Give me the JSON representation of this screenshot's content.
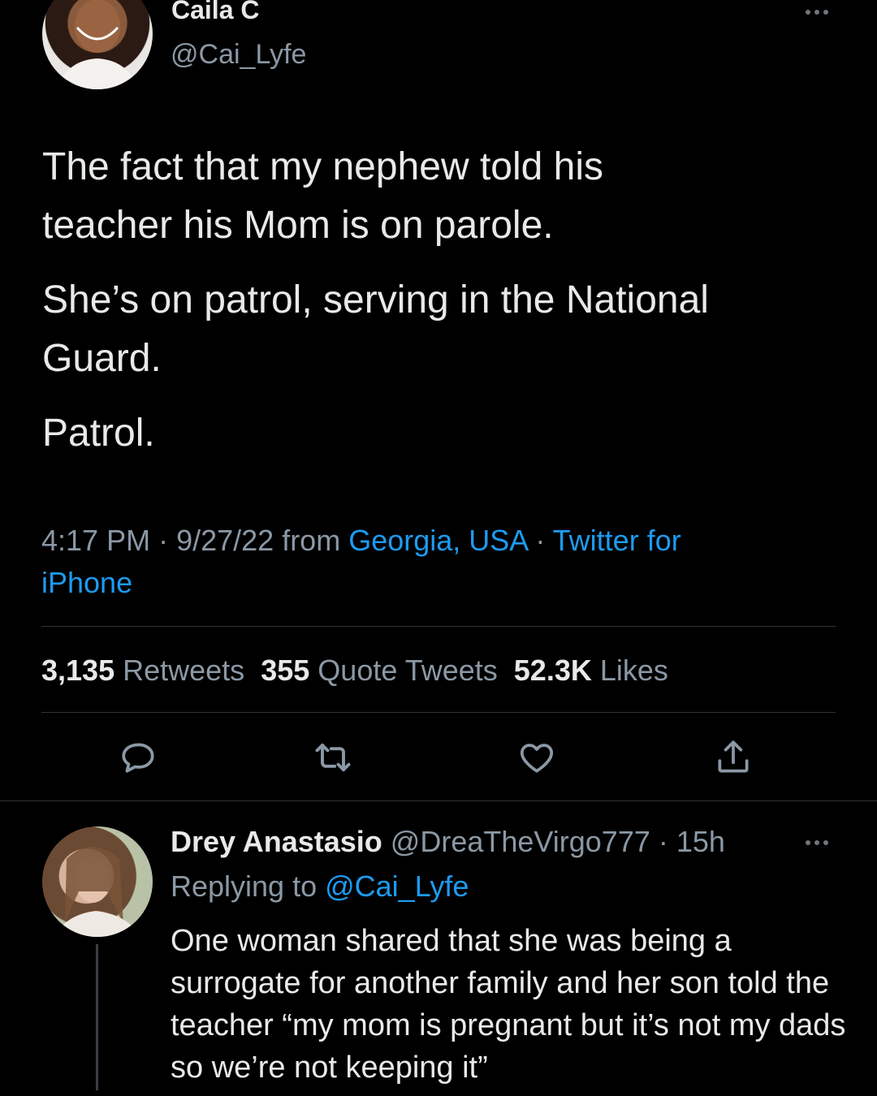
{
  "tweet": {
    "author_name": "Caila C",
    "author_handle": "@Cai_Lyfe",
    "paragraphs": [
      "The fact that my nephew told his teacher his Mom is on parole.",
      "She’s on patrol, serving in the National Guard.",
      "Patrol."
    ],
    "time": "4:17 PM",
    "sep1": " · ",
    "date": "9/27/22 from ",
    "location": "Georgia, USA",
    "sep2": " · ",
    "source": "Twitter for iPhone",
    "stats": {
      "retweets_count": "3,135",
      "retweets_label": "Retweets",
      "quotes_count": "355",
      "quotes_label": "Quote Tweets",
      "likes_count": "52.3K",
      "likes_label": "Likes"
    },
    "actions": {
      "reply_icon": "reply-icon",
      "retweet_icon": "retweet-icon",
      "like_icon": "heart-icon",
      "share_icon": "share-icon"
    }
  },
  "reply": {
    "author_name": "Drey Anastasio",
    "author_handle": "@DreaTheVirgo777",
    "time": " · 15h",
    "replying_prefix": "Replying to ",
    "replying_handle": "@Cai_Lyfe",
    "text": "One woman shared that she was being a surrogate for another family and her son told the teacher “my mom is pregnant but it’s not my dads so we’re not keeping it”"
  },
  "colors": {
    "background": "#000000",
    "text": "#e7e9ea",
    "muted": "#8b98a5",
    "link": "#1d9bf0",
    "divider": "#2f3336"
  }
}
